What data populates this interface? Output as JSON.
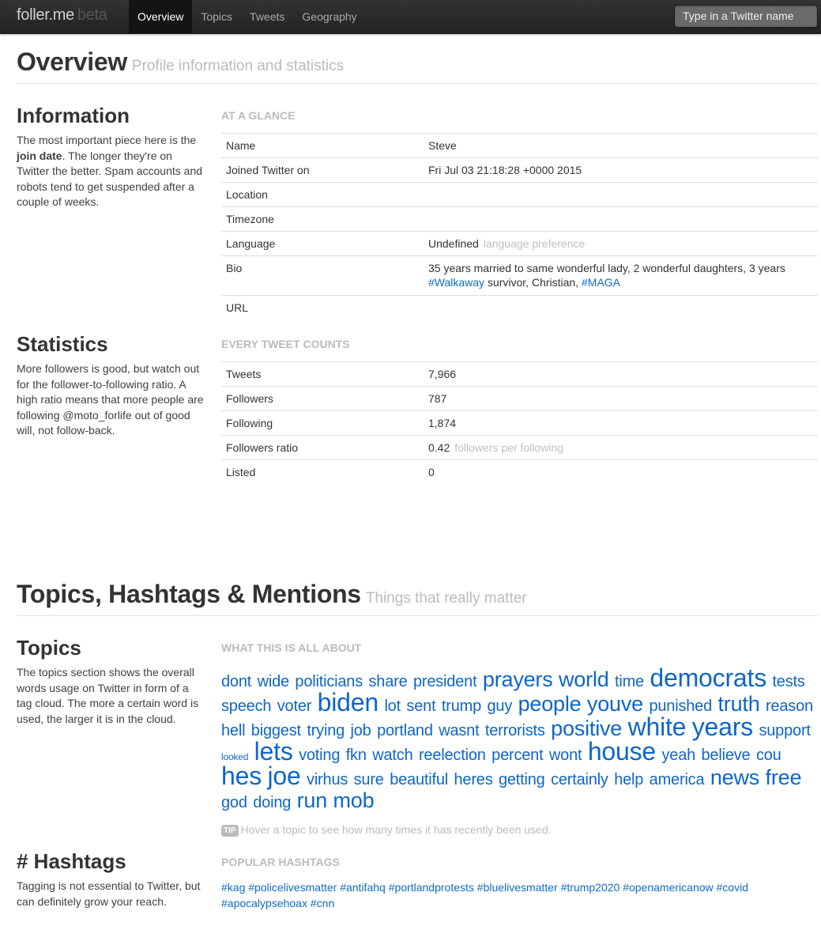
{
  "navbar": {
    "brand": "foller.me",
    "brand_suffix": "beta",
    "items": [
      {
        "label": "Overview",
        "active": true
      },
      {
        "label": "Topics",
        "active": false
      },
      {
        "label": "Tweets",
        "active": false
      },
      {
        "label": "Geography",
        "active": false
      }
    ],
    "search_placeholder": "Type in a Twitter name"
  },
  "overview": {
    "title": "Overview",
    "subtitle": "Profile information and statistics",
    "information": {
      "heading": "Information",
      "desc_pre": "The most important piece here is the ",
      "desc_bold": "join date",
      "desc_post": ". The longer they're on Twitter the better. Spam accounts and robots tend to get suspended after a couple of weeks.",
      "table_title": "At a glance",
      "rows": [
        {
          "label": "Name",
          "value": "Steve"
        },
        {
          "label": "Joined Twitter on",
          "value": "Fri Jul 03 21:18:28 +0000 2015"
        },
        {
          "label": "Location",
          "value": ""
        },
        {
          "label": "Timezone",
          "value": ""
        },
        {
          "label": "Language",
          "value": "Undefined",
          "note": "language preference"
        },
        {
          "label": "Bio",
          "value": ""
        },
        {
          "label": "URL",
          "value": ""
        }
      ],
      "bio": {
        "text1": "35 years married to same wonderful lady, 2 wonderful daughters, 3 years ",
        "tag1": "#Walkaway",
        "text2": " survivor, Christian, ",
        "tag2": "#MAGA"
      }
    },
    "statistics": {
      "heading": "Statistics",
      "desc": "More followers is good, but watch out for the follower-to-following ratio. A high ratio means that more people are following @moto_forlife out of good will, not follow-back.",
      "table_title": "Every tweet counts",
      "rows": [
        {
          "label": "Tweets",
          "value": "7,966"
        },
        {
          "label": "Followers",
          "value": "787"
        },
        {
          "label": "Following",
          "value": "1,874"
        },
        {
          "label": "Followers ratio",
          "value": "0.42",
          "note": "followers per following"
        },
        {
          "label": "Listed",
          "value": "0"
        }
      ]
    }
  },
  "topics_section": {
    "title": "Topics, Hashtags & Mentions",
    "subtitle": "Things that really matter",
    "topics": {
      "heading": "Topics",
      "desc": "The topics section shows the overall words usage on Twitter in form of a tag cloud. The more a certain word is used, the larger it is in the cloud.",
      "cloud_title": "What this is all about",
      "words": [
        {
          "w": "dont",
          "s": 2
        },
        {
          "w": "wide",
          "s": 2
        },
        {
          "w": "politicians",
          "s": 2
        },
        {
          "w": "share",
          "s": 2
        },
        {
          "w": "president",
          "s": 2
        },
        {
          "w": "prayers",
          "s": 3
        },
        {
          "w": "world",
          "s": 3
        },
        {
          "w": "time",
          "s": 2
        },
        {
          "w": "democrats",
          "s": 4
        },
        {
          "w": "tests",
          "s": 2
        },
        {
          "w": "speech",
          "s": 2
        },
        {
          "w": "voter",
          "s": 2
        },
        {
          "w": "biden",
          "s": 4
        },
        {
          "w": "lot",
          "s": 2
        },
        {
          "w": "sent",
          "s": 2
        },
        {
          "w": "trump",
          "s": 2
        },
        {
          "w": "guy",
          "s": 2
        },
        {
          "w": "people",
          "s": 3
        },
        {
          "w": "youve",
          "s": 3
        },
        {
          "w": "punished",
          "s": 2
        },
        {
          "w": "truth",
          "s": 3
        },
        {
          "w": "reason",
          "s": 2
        },
        {
          "w": "hell",
          "s": 2
        },
        {
          "w": "biggest",
          "s": 2
        },
        {
          "w": "trying",
          "s": 2
        },
        {
          "w": "job",
          "s": 2
        },
        {
          "w": "portland",
          "s": 2
        },
        {
          "w": "wasnt",
          "s": 2
        },
        {
          "w": "terrorists",
          "s": 2
        },
        {
          "w": "positive",
          "s": 3
        },
        {
          "w": "white",
          "s": 4
        },
        {
          "w": "years",
          "s": 4
        },
        {
          "w": "support",
          "s": 2
        },
        {
          "w": "looked",
          "s": 1
        },
        {
          "w": "lets",
          "s": 4
        },
        {
          "w": "voting",
          "s": 2
        },
        {
          "w": "fkn",
          "s": 2
        },
        {
          "w": "watch",
          "s": 2
        },
        {
          "w": "reelection",
          "s": 2
        },
        {
          "w": "percent",
          "s": 2
        },
        {
          "w": "wont",
          "s": 2
        },
        {
          "w": "house",
          "s": 4
        },
        {
          "w": "yeah",
          "s": 2
        },
        {
          "w": "believe",
          "s": 2
        },
        {
          "w": "cou",
          "s": 2
        },
        {
          "w": "hes",
          "s": 4
        },
        {
          "w": "joe",
          "s": 4
        },
        {
          "w": "virhus",
          "s": 2
        },
        {
          "w": "sure",
          "s": 2
        },
        {
          "w": "beautiful",
          "s": 2
        },
        {
          "w": "heres",
          "s": 2
        },
        {
          "w": "getting",
          "s": 2
        },
        {
          "w": "certainly",
          "s": 2
        },
        {
          "w": "help",
          "s": 2
        },
        {
          "w": "america",
          "s": 2
        },
        {
          "w": "news",
          "s": 3
        },
        {
          "w": "free",
          "s": 3
        },
        {
          "w": "god",
          "s": 2
        },
        {
          "w": "doing",
          "s": 2
        },
        {
          "w": "run",
          "s": 3
        },
        {
          "w": "mob",
          "s": 3
        }
      ],
      "tip_badge": "TIP",
      "tip_text": "Hover a topic to see how many times it has recently been used."
    },
    "hashtags": {
      "heading": "# Hashtags",
      "desc": "Tagging is not essential to Twitter, but can definitely grow your reach.",
      "list_title": "Popular hashtags",
      "tags": [
        "#kag",
        "#policelivesmatter",
        "#antifahq",
        "#portlandprotests",
        "#bluelivesmatter",
        "#trump2020",
        "#openamericanow",
        "#covid",
        "#apocalypsehoax",
        "#cnn"
      ]
    }
  }
}
